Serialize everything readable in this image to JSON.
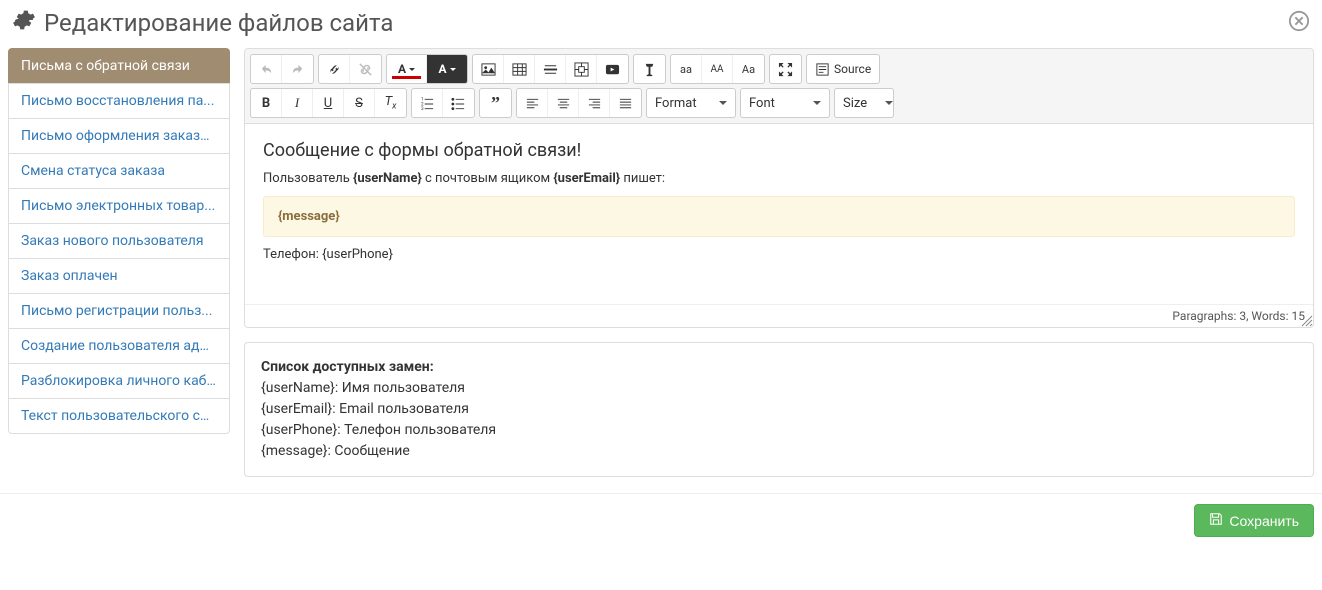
{
  "header": {
    "title": "Редактирование файлов сайта"
  },
  "sidebar": {
    "items": [
      {
        "label": "Письма с обратной связи",
        "active": true
      },
      {
        "label": "Письмо восстановления па..."
      },
      {
        "label": "Письмо оформления заказа..."
      },
      {
        "label": "Смена статуса заказа"
      },
      {
        "label": "Письмо электронных товар..."
      },
      {
        "label": "Заказ нового пользователя"
      },
      {
        "label": "Заказ оплачен"
      },
      {
        "label": "Письмо регистрации польз..."
      },
      {
        "label": "Создание пользователя адм..."
      },
      {
        "label": "Разблокировка личного каб..."
      },
      {
        "label": "Текст пользовательского со..."
      }
    ]
  },
  "toolbar": {
    "source_label": "Source",
    "format_label": "Format",
    "font_label": "Font",
    "size_label": "Size"
  },
  "content": {
    "heading": "Сообщение с формы обратной связи!",
    "line1_prefix": "Пользователь ",
    "line1_var1": "{userName}",
    "line1_mid": " с почтовым ящиком ",
    "line1_var2": "{userEmail}",
    "line1_suffix": " пишет:",
    "message_var": "{message}",
    "phone_line": "Телефон: {userPhone}"
  },
  "status": {
    "text": "Paragraphs: 3, Words: 15"
  },
  "replacements": {
    "title": "Список доступных замен:",
    "items": [
      "{userName}: Имя пользователя",
      "{userEmail}: Email пользователя",
      "{userPhone}: Телефон пользователя",
      "{message}: Сообщение"
    ]
  },
  "footer": {
    "save_label": "Сохранить"
  }
}
